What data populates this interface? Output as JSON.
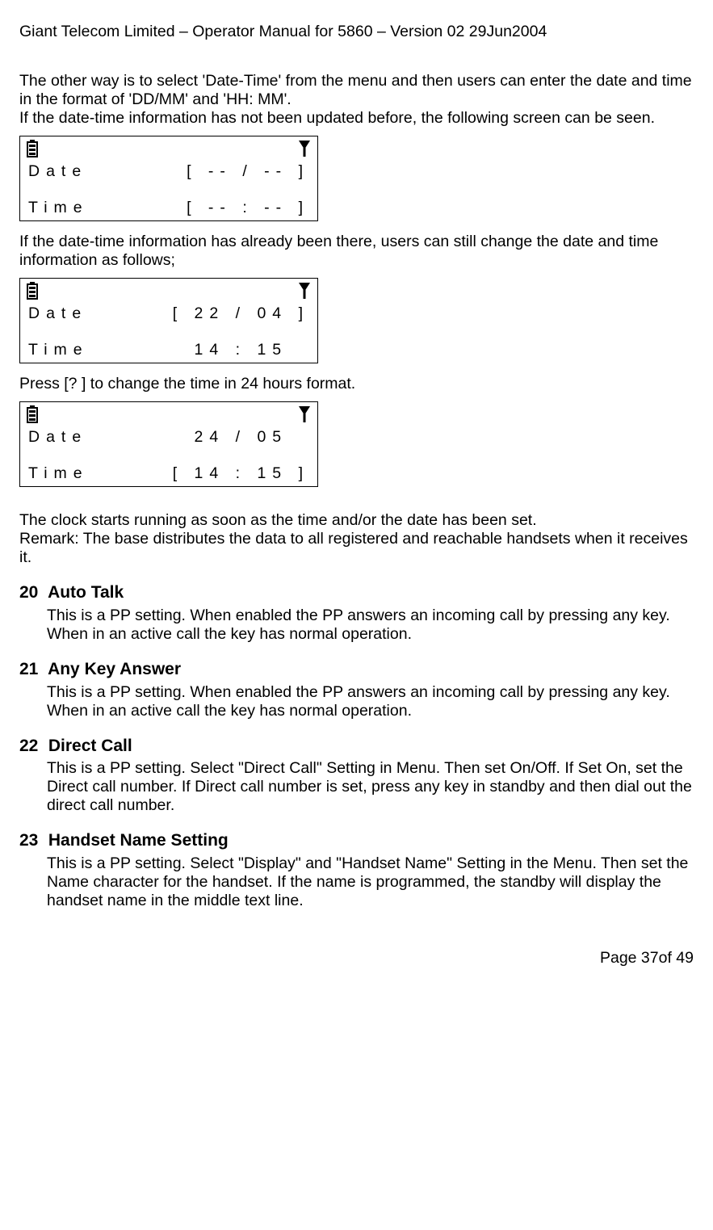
{
  "header": "Giant Telecom Limited – Operator Manual for 5860 – Version 02 29Jun2004",
  "intro": {
    "p1": "The other way is to select 'Date-Time' from the menu and then users can enter the date and time in the format of 'DD/MM' and 'HH: MM'.",
    "p2": "If the date-time information has not been updated before, the following screen can be seen."
  },
  "lcd1": {
    "row1_label": "Date",
    "row1_value": "[ -- / -- ]",
    "row2_label": "Time",
    "row2_value": "[ -- : -- ]"
  },
  "mid1": "If the date-time information has already been there, users can still change the date and time information as follows;",
  "lcd2": {
    "row1_label": "Date",
    "row1_value": "[ 22 / 04 ]",
    "row2_label": "Time",
    "row2_value": "  14 : 15  "
  },
  "mid2": "Press [?  ] to change the time in 24 hours format.",
  "lcd3": {
    "row1_label": "Date",
    "row1_value": "  24 / 05  ",
    "row2_label": "Time",
    "row2_value": "[ 14 : 15 ]"
  },
  "after": {
    "p1": "The clock starts running as soon as the time and/or the date has been set.",
    "p2": "Remark: The base distributes the data to all registered and reachable handsets when it receives it."
  },
  "s20": {
    "num": "20",
    "title": "Auto Talk",
    "body": "This is a PP setting. When enabled the PP answers an incoming call by pressing any key. When in an active call the key has normal operation."
  },
  "s21": {
    "num": "21",
    "title": "Any Key Answer",
    "body": "This is a PP setting. When enabled the PP answers an incoming call by pressing any key. When in an active call the key has normal operation."
  },
  "s22": {
    "num": "22",
    "title": "Direct Call",
    "body": "This is a PP setting. Select \"Direct Call\" Setting in Menu. Then set On/Off. If Set On, set the Direct call number. If Direct call number is set, press any key in standby and then dial out the direct call number."
  },
  "s23": {
    "num": "23",
    "title": "Handset Name Setting",
    "body": "This is a PP setting. Select \"Display\" and \"Handset Name\" Setting in the Menu. Then set the Name character for the handset. If the name is programmed, the standby will display the handset name in the middle text line."
  },
  "footer": "Page 37of 49"
}
